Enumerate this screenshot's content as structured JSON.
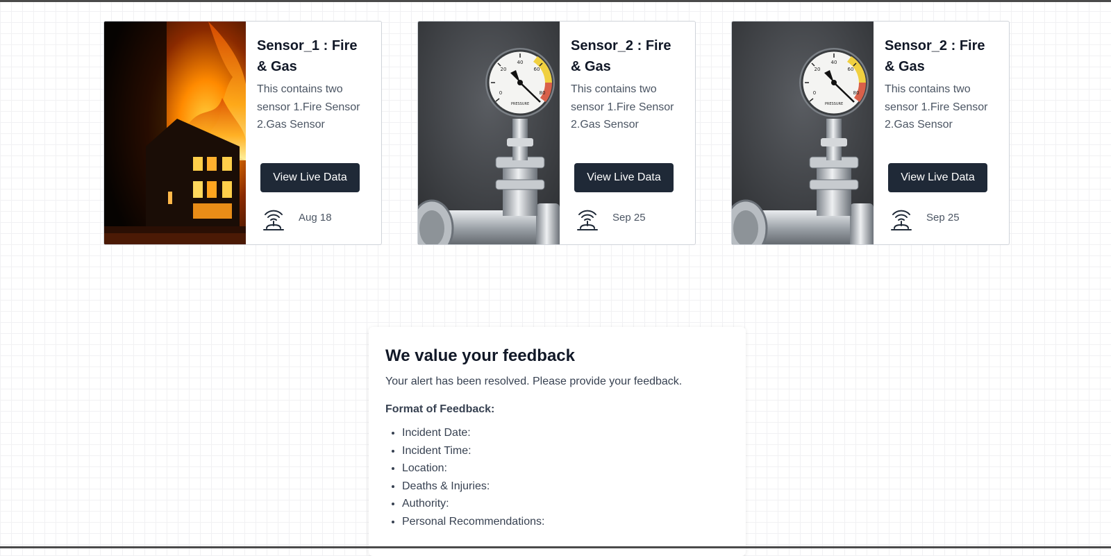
{
  "cards": [
    {
      "title": "Sensor_1 : Fire & Gas",
      "description": "This contains two sensor 1.Fire Sensor 2.Gas Sensor",
      "button_label": "View Live Data",
      "date": "Aug 18",
      "image": "burning-house-photo"
    },
    {
      "title": "Sensor_2 : Fire & Gas",
      "description": "This contains two sensor 1.Fire Sensor 2.Gas Sensor",
      "button_label": "View Live Data",
      "date": "Sep 25",
      "image": "pressure-gauge-photo"
    },
    {
      "title": "Sensor_2 : Fire & Gas",
      "description": "This contains two sensor 1.Fire Sensor 2.Gas Sensor",
      "button_label": "View Live Data",
      "date": "Sep 25",
      "image": "pressure-gauge-photo"
    }
  ],
  "icons": {
    "footer": "wireless-sensor-icon"
  },
  "gauge": {
    "brand": "PRESSURE",
    "ticks": [
      "0",
      "20",
      "40",
      "60",
      "80"
    ]
  },
  "feedback": {
    "title": "We value your feedback",
    "subtitle": "Your alert has been resolved. Please provide your feedback.",
    "format_label": "Format of Feedback:",
    "items": [
      "Incident Date:",
      "Incident Time:",
      "Location:",
      "Deaths & Injuries:",
      "Authority:",
      "Personal Recommendations:"
    ]
  },
  "colors": {
    "button_bg": "#1f2937",
    "title_text": "#111827",
    "body_text": "#4b5563",
    "card_border": "#cfd3d9"
  }
}
